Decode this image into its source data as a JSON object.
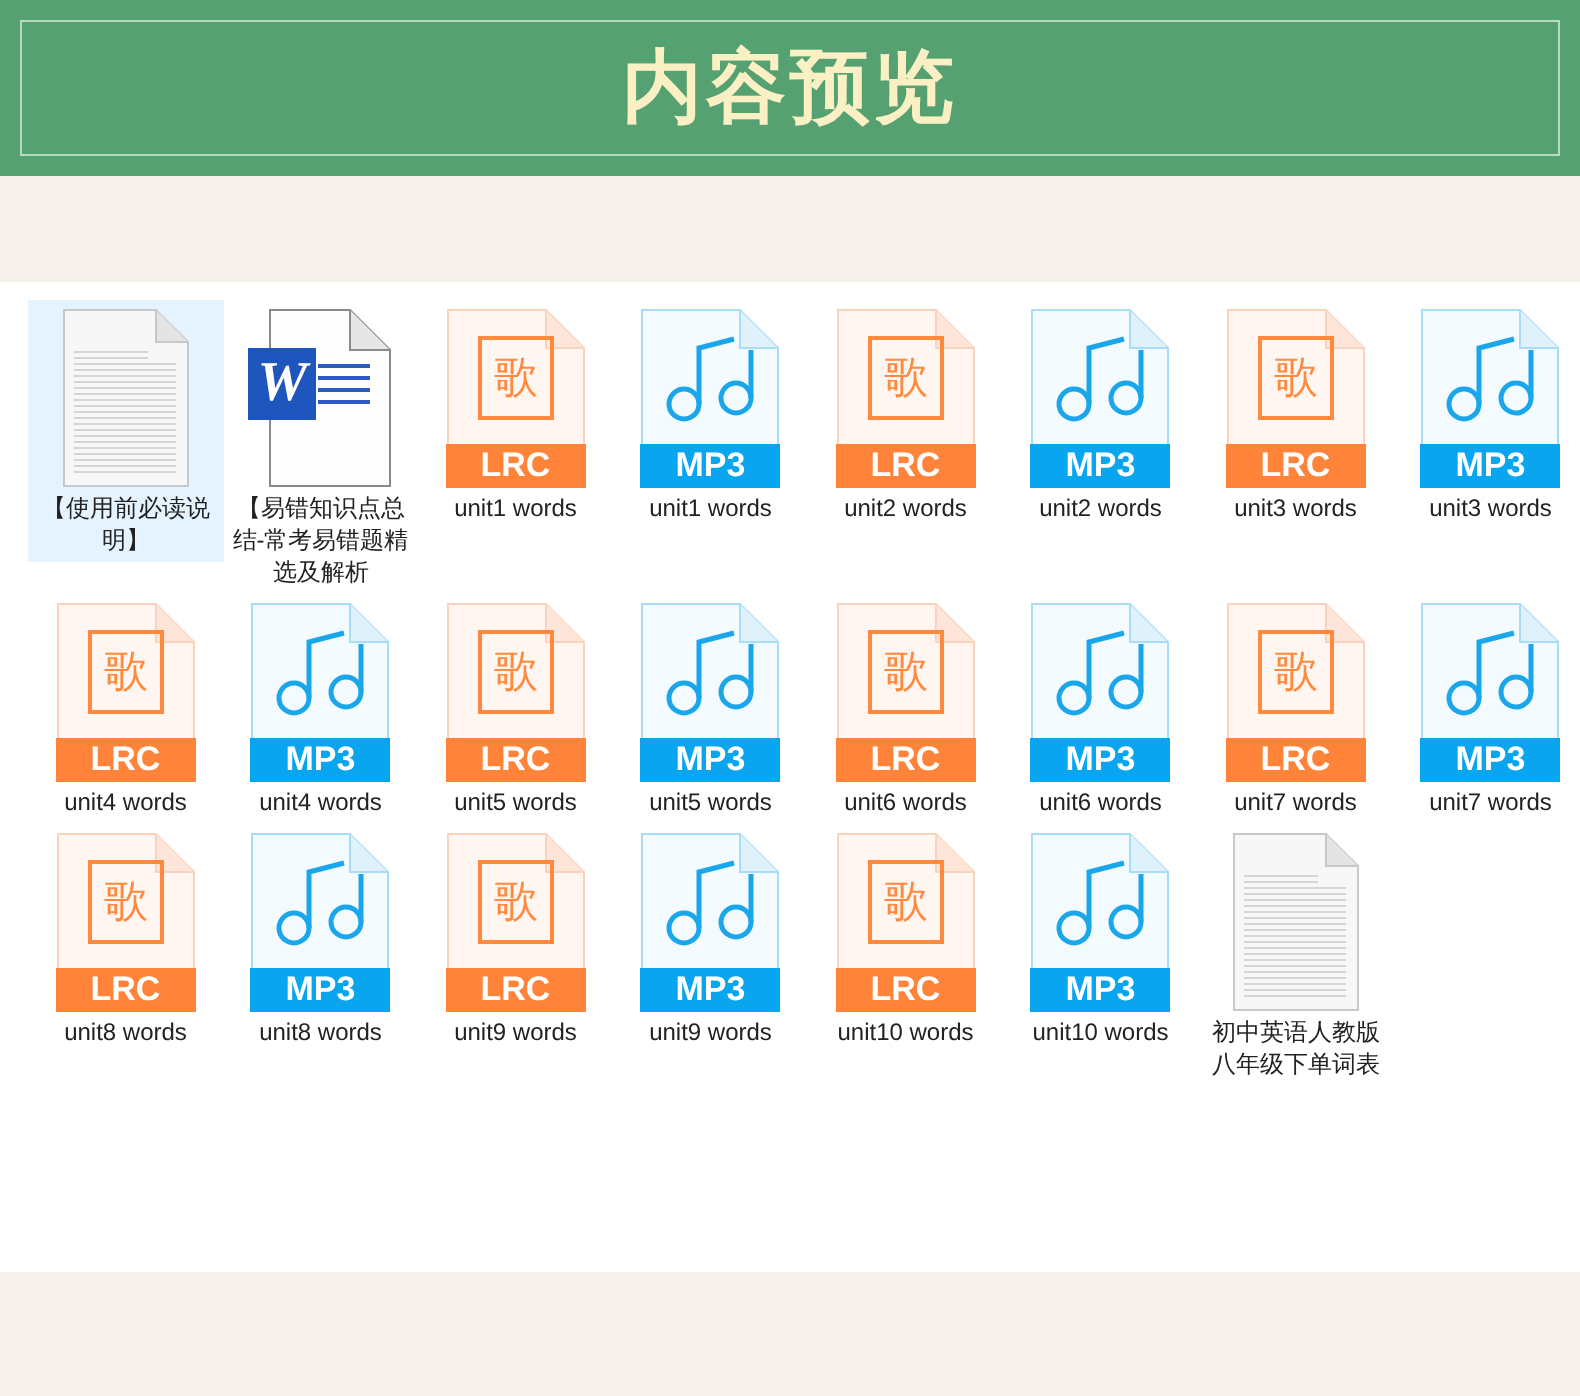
{
  "header": {
    "title": "内容预览"
  },
  "files": [
    {
      "kind": "text",
      "name": "【使用前必读说明】",
      "selected": true
    },
    {
      "kind": "word",
      "name": "【易错知识点总结-常考易错题精选及解析",
      "logo_letter": "W",
      "selected": false
    },
    {
      "kind": "lrc",
      "name": "unit1 words",
      "glyph": "歌",
      "badge": "LRC",
      "selected": false
    },
    {
      "kind": "mp3",
      "name": "unit1 words",
      "badge": "MP3",
      "selected": false
    },
    {
      "kind": "lrc",
      "name": "unit2 words",
      "glyph": "歌",
      "badge": "LRC",
      "selected": false
    },
    {
      "kind": "mp3",
      "name": "unit2 words",
      "badge": "MP3",
      "selected": false
    },
    {
      "kind": "lrc",
      "name": "unit3 words",
      "glyph": "歌",
      "badge": "LRC",
      "selected": false
    },
    {
      "kind": "mp3",
      "name": "unit3 words",
      "badge": "MP3",
      "selected": false
    },
    {
      "kind": "lrc",
      "name": "unit4 words",
      "glyph": "歌",
      "badge": "LRC",
      "selected": false
    },
    {
      "kind": "mp3",
      "name": "unit4 words",
      "badge": "MP3",
      "selected": false
    },
    {
      "kind": "lrc",
      "name": "unit5 words",
      "glyph": "歌",
      "badge": "LRC",
      "selected": false
    },
    {
      "kind": "mp3",
      "name": "unit5 words",
      "badge": "MP3",
      "selected": false
    },
    {
      "kind": "lrc",
      "name": "unit6 words",
      "glyph": "歌",
      "badge": "LRC",
      "selected": false
    },
    {
      "kind": "mp3",
      "name": "unit6 words",
      "badge": "MP3",
      "selected": false
    },
    {
      "kind": "lrc",
      "name": "unit7 words",
      "glyph": "歌",
      "badge": "LRC",
      "selected": false
    },
    {
      "kind": "mp3",
      "name": "unit7 words",
      "badge": "MP3",
      "selected": false
    },
    {
      "kind": "lrc",
      "name": "unit8 words",
      "glyph": "歌",
      "badge": "LRC",
      "selected": false
    },
    {
      "kind": "mp3",
      "name": "unit8 words",
      "badge": "MP3",
      "selected": false
    },
    {
      "kind": "lrc",
      "name": "unit9 words",
      "glyph": "歌",
      "badge": "LRC",
      "selected": false
    },
    {
      "kind": "mp3",
      "name": "unit9 words",
      "badge": "MP3",
      "selected": false
    },
    {
      "kind": "lrc",
      "name": "unit10 words",
      "glyph": "歌",
      "badge": "LRC",
      "selected": false
    },
    {
      "kind": "mp3",
      "name": "unit10 words",
      "badge": "MP3",
      "selected": false
    },
    {
      "kind": "text",
      "name": "初中英语人教版八年级下单词表",
      "selected": false
    }
  ]
}
